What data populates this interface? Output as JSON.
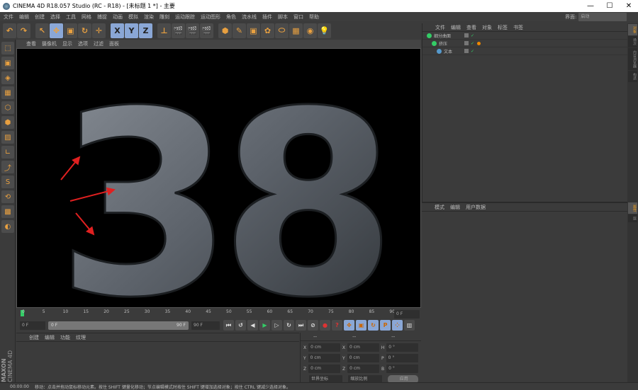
{
  "window": {
    "title": "CINEMA 4D R18.057 Studio (RC - R18) - [未标题 1 *] - 主要",
    "minimize": "—",
    "maximize": "☐",
    "close": "✕"
  },
  "menu": [
    "文件",
    "编辑",
    "创建",
    "选择",
    "工具",
    "网格",
    "捕捉",
    "动画",
    "模拟",
    "渲染",
    "雕刻",
    "运动跟踪",
    "运动图形",
    "角色",
    "流水线",
    "插件",
    "脚本",
    "窗口",
    "帮助"
  ],
  "layout": {
    "label": "界面:",
    "value": "启动"
  },
  "toolbar": [
    "↶",
    "↷",
    "↖",
    "✥",
    "▣",
    "↻",
    "✛",
    "X",
    "Y",
    "Z",
    "⊥",
    "🎬",
    "🎬",
    "🎬",
    "⬢",
    "✎",
    "▣",
    "✿",
    "⬭",
    "▦",
    "◉",
    "💡"
  ],
  "viewport": {
    "menu": [
      "查看",
      "摄像机",
      "显示",
      "选项",
      "过滤",
      "面板"
    ],
    "text": "38"
  },
  "timeline": {
    "ticks": [
      "0",
      "5",
      "10",
      "15",
      "20",
      "25",
      "30",
      "35",
      "40",
      "45",
      "50",
      "55",
      "60",
      "65",
      "70",
      "75",
      "80",
      "85",
      "90"
    ],
    "current": "0 F"
  },
  "controls": {
    "start": "0 F",
    "range_start": "0 F",
    "range_end": "90 F",
    "end": "90 F"
  },
  "material": {
    "menu": [
      "创建",
      "编辑",
      "功能",
      "纹理"
    ],
    "brand": "MAXON",
    "brand2": "CINEMA 4D"
  },
  "coords": {
    "headers": [
      "--",
      "--",
      "--"
    ],
    "rows": [
      [
        "X",
        "0 cm",
        "X",
        "0 cm",
        "H",
        "0 °"
      ],
      [
        "Y",
        "0 cm",
        "Y",
        "0 cm",
        "P",
        "0 °"
      ],
      [
        "Z",
        "0 cm",
        "Z",
        "0 cm",
        "B",
        "0 °"
      ]
    ],
    "mode1": "世界坐标",
    "mode2": "缩放比例",
    "apply": "应用"
  },
  "objects": {
    "menu": [
      "文件",
      "编辑",
      "查看",
      "对象",
      "标签",
      "书签"
    ],
    "items": [
      {
        "name": "细分曲面",
        "indent": 0
      },
      {
        "name": "挤压",
        "indent": 1
      },
      {
        "name": "文本",
        "indent": 2
      }
    ]
  },
  "attributes": {
    "menu": [
      "模式",
      "编辑",
      "用户数据"
    ]
  },
  "righttabs": [
    "对象",
    "场次",
    "内容浏览器",
    "构造",
    "属性",
    "层"
  ],
  "status": {
    "time": "00:00:00",
    "message": "移动：点击并拖动鼠标移动元素。按住 SHIFT 键量化移动；节点编辑模式时按住 SHIFT 键增加选择对象；按住 CTRL 键减少选择对象。"
  }
}
